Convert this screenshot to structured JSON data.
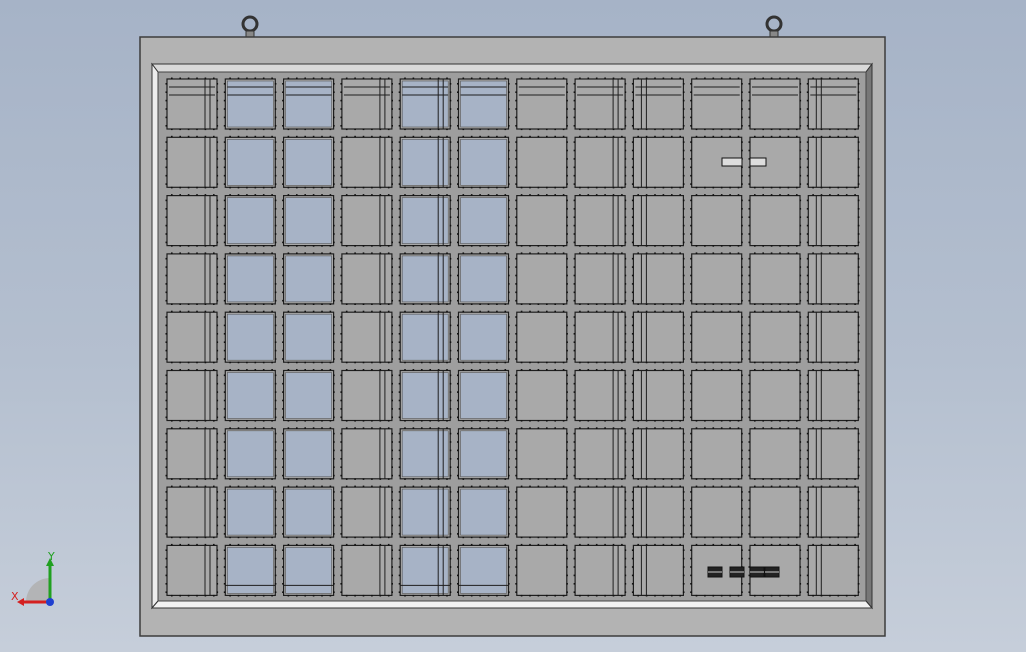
{
  "viewport": {
    "name": "3D model view",
    "colors": {
      "frame": "#b3b3b3",
      "frame_edge": "#3c3c3c",
      "inner_bg": "#9e9e9e",
      "module": "#a9a9a9",
      "glass": "#a7b3c6",
      "line": "#1e1e1e"
    },
    "grid": {
      "rows": 9,
      "cols": 12
    },
    "glass_columns": [
      1,
      2,
      4,
      5
    ],
    "divided_columns": [
      0,
      3,
      4,
      7,
      8,
      11
    ],
    "lifting_eyes": 2
  },
  "triad": {
    "x_label": "X",
    "y_label": "Y",
    "x_color": "#d42020",
    "y_color": "#20a020",
    "z_color": "#2040d0"
  }
}
